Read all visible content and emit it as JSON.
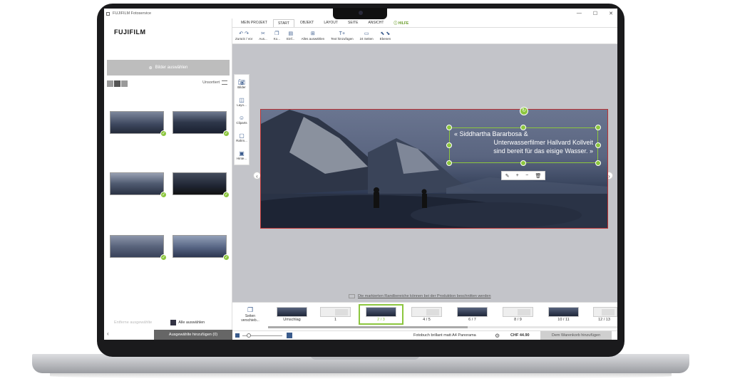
{
  "window": {
    "title": "FUJIFILM Fotoservice",
    "controls": [
      "—",
      "☐",
      "✕"
    ]
  },
  "sidebar": {
    "logo": "FUJIFILM",
    "pick_images": "Bilder auswählen",
    "sort_label": "Unsortiert",
    "remove_selected": "Entferne ausgewählte",
    "select_all": "Alle auswählen",
    "add_selected": "Ausgewählte hinzufügen (0)"
  },
  "tabs": [
    "MEIN PROJEKT",
    "START",
    "OBJEKT",
    "LAYOUT",
    "SEITE",
    "ANSICHT",
    "HILFE"
  ],
  "toolbar": {
    "undo_redo": "Zurück / Vor",
    "cut": "Aus...",
    "copy": "Ko...",
    "paste": "Einf...",
    "select_all": "Alles auswählen",
    "add_text": "Text hinzufügen",
    "pages": "24 Seiten",
    "layers": "Ebenen"
  },
  "side_tools": [
    "Bilder",
    "Layo...",
    "Cliparts",
    "Rahm...",
    "Hinte..."
  ],
  "caption": {
    "line1": "« Siddhartha Bararbosa &",
    "line2": "Unterwasserfilmer Hallvard Kollveit",
    "line3": "sind bereit für das eisige Wasser. »"
  },
  "note": "Die markierten Randbereiche können bei der Produktion beschnitten werden",
  "move_pages": "Seiten verschieb...",
  "page_labels": [
    "Umschlag",
    "1",
    "2 / 3",
    "4 / 5",
    "6 / 7",
    "8 / 9",
    "10 / 11",
    "12 / 13"
  ],
  "bottom": {
    "product": "Fotobuch brillant matt A4 Panorama",
    "price": "CHF 44.90",
    "cart": "Dem Warenkorb hinzufügen"
  },
  "colors": {
    "accent": "#8cc63e",
    "tool_icon": "#3a5b8c"
  }
}
